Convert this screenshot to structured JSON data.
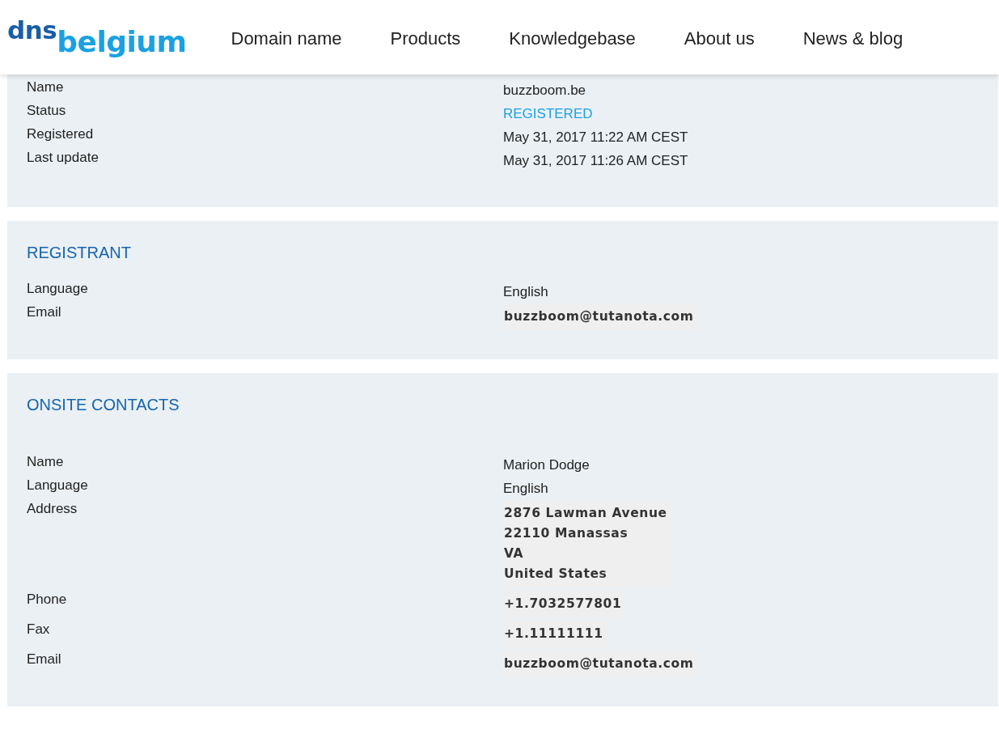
{
  "header": {
    "logo": {
      "part_1": "dns",
      "part_2": "belgium"
    },
    "nav": [
      "Domain name",
      "Products",
      "Knowledgebase",
      "About us",
      "News & blog"
    ]
  },
  "sections": [
    {
      "fields": [
        {
          "label": "Name",
          "kind": "text",
          "value": "buzzboom.be"
        },
        {
          "label": "Status",
          "kind": "status",
          "value": "REGISTERED"
        },
        {
          "label": "Registered",
          "kind": "text",
          "value": "May 31, 2017 11:22 AM CEST"
        },
        {
          "label": "Last update",
          "kind": "text",
          "value": "May 31, 2017 11:26 AM CEST"
        }
      ]
    },
    {
      "title": "REGISTRANT",
      "fields": [
        {
          "label": "Language",
          "kind": "text",
          "value": "English"
        },
        {
          "label": "Email",
          "kind": "image",
          "lines": [
            "buzzboom@tutanota.com"
          ]
        }
      ]
    },
    {
      "title": "ONSITE CONTACTS",
      "fields": [
        {
          "label": "Name",
          "kind": "text",
          "value": "Marion Dodge"
        },
        {
          "label": "Language",
          "kind": "text",
          "value": "English"
        },
        {
          "label": "Address",
          "kind": "image",
          "lines": [
            "2876 Lawman Avenue",
            "22110 Manassas",
            "VA",
            "United States"
          ]
        },
        {
          "label": "Phone",
          "kind": "image",
          "lines": [
            "+1.7032577801"
          ]
        },
        {
          "label": "Fax",
          "kind": "image",
          "lines": [
            "+1.11111111"
          ]
        },
        {
          "label": "Email",
          "kind": "image",
          "lines": [
            "buzzboom@tutanota.com"
          ]
        }
      ]
    }
  ]
}
